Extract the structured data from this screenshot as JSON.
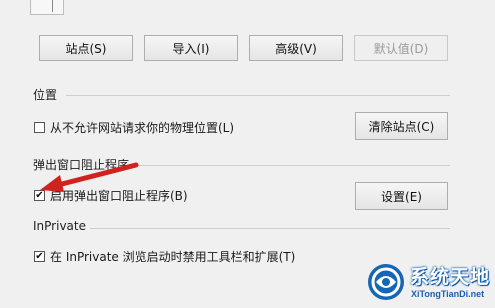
{
  "buttons": {
    "sites": "站点(S)",
    "import": "导入(I)",
    "advanced": "高级(V)",
    "default": "默认值(D)",
    "clear_sites": "清除站点(C)",
    "settings": "设置(E)"
  },
  "location": {
    "title": "位置",
    "never_allow_label": "从不允许网站请求你的物理位置(L)",
    "never_allow_checked": false
  },
  "popup_blocker": {
    "title": "弹出窗口阻止程序",
    "enable_label": "启用弹出窗口阻止程序(B)",
    "enable_checked": true
  },
  "inprivate": {
    "title": "InPrivate",
    "disable_toolbars_label": "在 InPrivate 浏览启动时禁用工具栏和扩展(T)",
    "disable_toolbars_checked": true
  },
  "watermark": {
    "title": "系统天地",
    "url": "XiTongTianDi.net"
  },
  "colors": {
    "annotation_arrow": "#d0231f",
    "watermark_blue": "#1566b7"
  }
}
